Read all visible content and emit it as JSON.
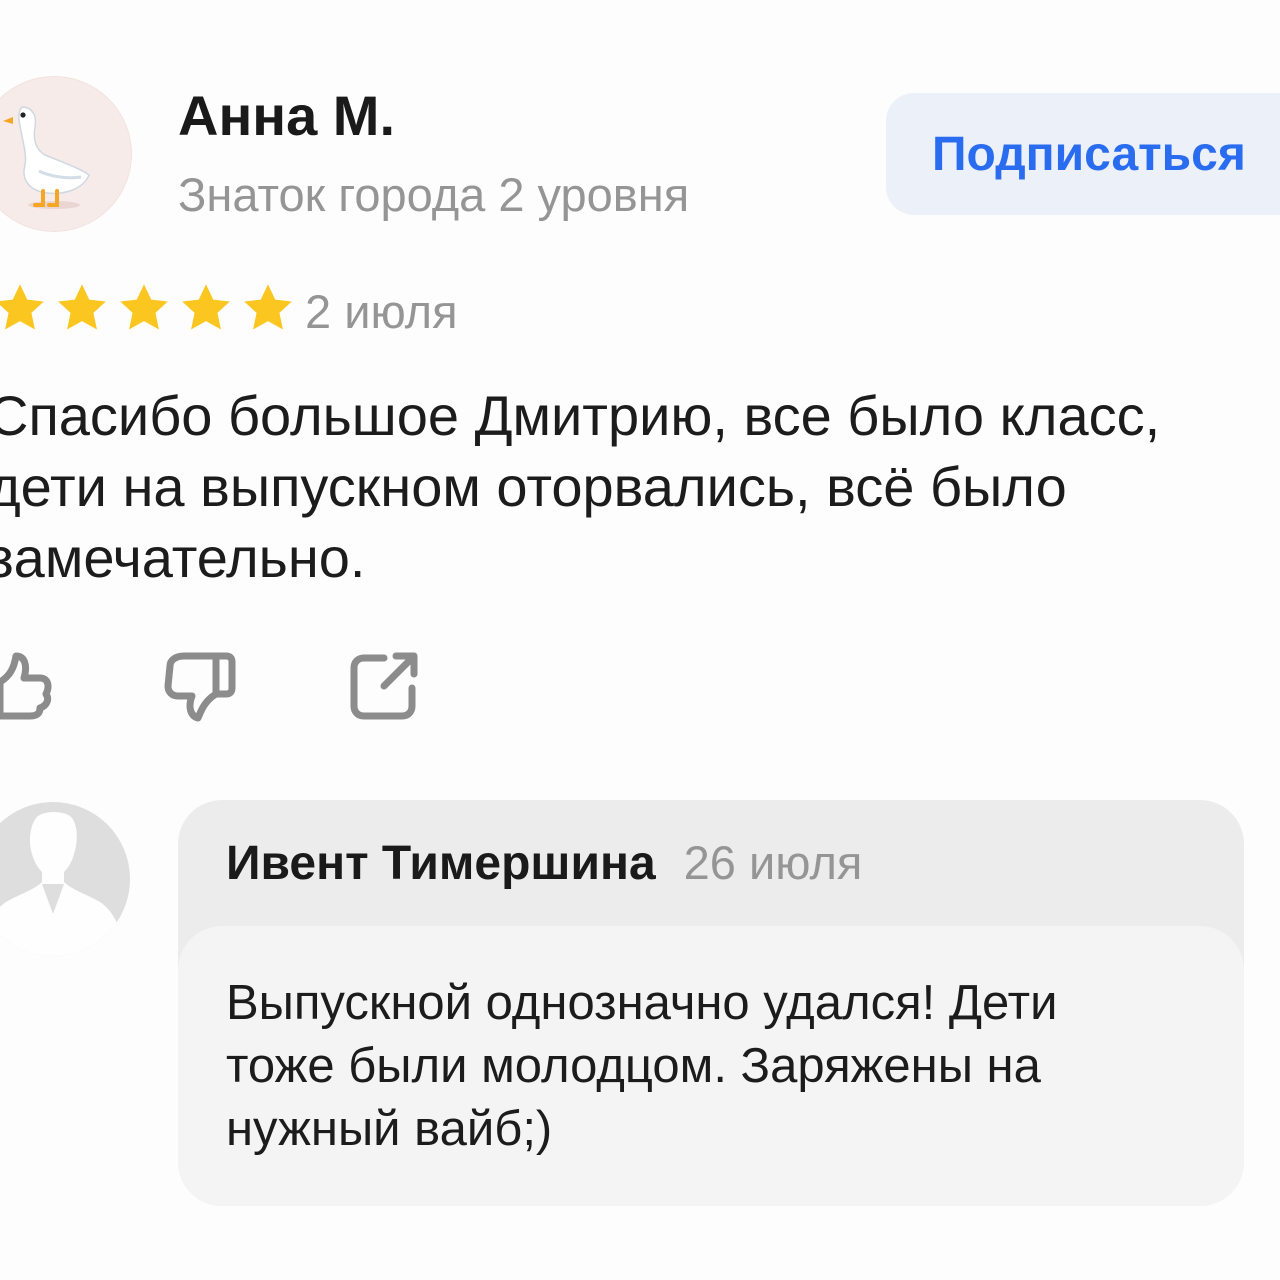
{
  "review": {
    "author": {
      "name": "Анна М.",
      "level": "Знаток города 2 уровня",
      "avatar_icon": "goose-emoji-icon"
    },
    "subscribe_label": "Подписаться",
    "rating": 5,
    "rating_max": 5,
    "date": "2 июля",
    "text": "Спасибо большое Дмитрию,  все было класс,\nдети на выпускном оторвались,  всё было\nзамечательно.",
    "actions": {
      "like_icon": "thumbs-up-icon",
      "dislike_icon": "thumbs-down-icon",
      "share_icon": "share-icon"
    }
  },
  "reply": {
    "author": "Ивент Тимершина",
    "date": "26 июля",
    "avatar_icon": "default-user-silhouette-icon",
    "text": "Выпускной однозначно удался! Дети\nтоже были молодцом. Заряжены на\nнужный вайб;)"
  },
  "colors": {
    "accent": "#2a6cf0",
    "star": "#fcc620",
    "muted_text": "#959595"
  }
}
